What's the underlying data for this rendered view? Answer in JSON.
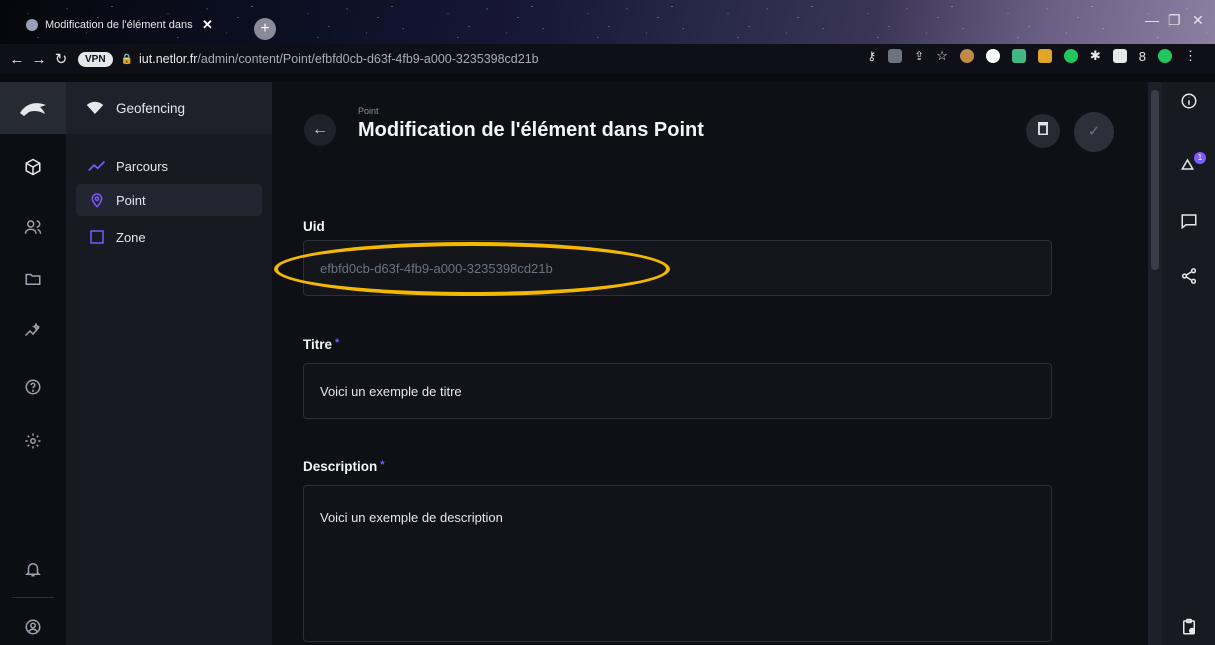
{
  "browser": {
    "tab_title": "Modification de l'élément dans P",
    "url_domain": "iut.netlor.fr",
    "url_path": "/admin/content/Point/efbfd0cb-d63f-4fb9-a000-3235398cd21b",
    "vpn_label": "VPN"
  },
  "sidebar": {
    "project_name": "Geofencing",
    "items": [
      {
        "label": "Parcours",
        "icon": "trend-line-icon"
      },
      {
        "label": "Point",
        "icon": "map-pin-icon"
      },
      {
        "label": "Zone",
        "icon": "square-icon"
      }
    ]
  },
  "header": {
    "breadcrumb": "Point",
    "title": "Modification de l'élément dans Point"
  },
  "form": {
    "uid_label": "Uid",
    "uid_value": "efbfd0cb-d63f-4fb9-a000-3235398cd21b",
    "titre_label": "Titre",
    "titre_value": "Voici un exemple de titre",
    "description_label": "Description",
    "description_value": "Voici un exemple de description",
    "required_mark": "*"
  },
  "notifications": {
    "badge_count": "1"
  },
  "colors": {
    "accent": "#7c5cff",
    "highlight": "#f5b800",
    "background": "#0e1015"
  }
}
